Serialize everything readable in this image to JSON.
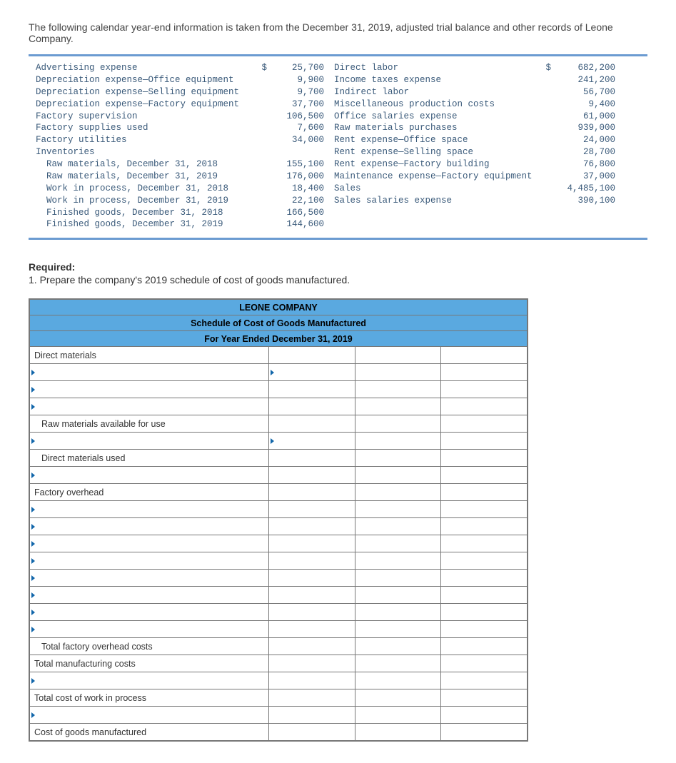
{
  "intro": "The following calendar year-end information is taken from the December 31, 2019, adjusted trial balance and other records of Leone Company.",
  "trial_balance": {
    "left": [
      {
        "label": "Advertising expense",
        "value": "25,700",
        "sym": "$"
      },
      {
        "label": "Depreciation expense—Office equipment",
        "value": "9,900",
        "sym": ""
      },
      {
        "label": "Depreciation expense—Selling equipment",
        "value": "9,700",
        "sym": ""
      },
      {
        "label": "Depreciation expense—Factory equipment",
        "value": "37,700",
        "sym": ""
      },
      {
        "label": "Factory supervision",
        "value": "106,500",
        "sym": ""
      },
      {
        "label": "Factory supplies used",
        "value": "7,600",
        "sym": ""
      },
      {
        "label": "Factory utilities",
        "value": "34,000",
        "sym": ""
      },
      {
        "label": "Inventories",
        "value": "",
        "sym": ""
      },
      {
        "label": "  Raw materials, December 31, 2018",
        "value": "155,100",
        "sym": ""
      },
      {
        "label": "  Raw materials, December 31, 2019",
        "value": "176,000",
        "sym": ""
      },
      {
        "label": "  Work in process, December 31, 2018",
        "value": "18,400",
        "sym": ""
      },
      {
        "label": "  Work in process, December 31, 2019",
        "value": "22,100",
        "sym": ""
      },
      {
        "label": "  Finished goods, December 31, 2018",
        "value": "166,500",
        "sym": ""
      },
      {
        "label": "  Finished goods, December 31, 2019",
        "value": "144,600",
        "sym": ""
      }
    ],
    "right": [
      {
        "label": "Direct labor",
        "value": "682,200",
        "sym": "$"
      },
      {
        "label": "Income taxes expense",
        "value": "241,200",
        "sym": ""
      },
      {
        "label": "Indirect labor",
        "value": "56,700",
        "sym": ""
      },
      {
        "label": "Miscellaneous production costs",
        "value": "9,400",
        "sym": ""
      },
      {
        "label": "Office salaries expense",
        "value": "61,000",
        "sym": ""
      },
      {
        "label": "Raw materials purchases",
        "value": "939,000",
        "sym": ""
      },
      {
        "label": "Rent expense—Office space",
        "value": "24,000",
        "sym": ""
      },
      {
        "label": "Rent expense—Selling space",
        "value": "28,700",
        "sym": ""
      },
      {
        "label": "Rent expense—Factory building",
        "value": "76,800",
        "sym": ""
      },
      {
        "label": "Maintenance expense—Factory equipment",
        "value": "37,000",
        "sym": ""
      },
      {
        "label": "Sales",
        "value": "4,485,100",
        "sym": ""
      },
      {
        "label": "Sales salaries expense",
        "value": "390,100",
        "sym": ""
      },
      {
        "label": "",
        "value": "",
        "sym": ""
      },
      {
        "label": "",
        "value": "",
        "sym": ""
      }
    ]
  },
  "required_header": "Required:",
  "required_text": "1. Prepare the company's 2019 schedule of cost of goods manufactured.",
  "schedule": {
    "h1": "LEONE COMPANY",
    "h2": "Schedule of Cost of Goods Manufactured",
    "h3": "For Year Ended December 31, 2019",
    "rows": {
      "direct_materials": "Direct materials",
      "raw_avail": "Raw materials available for use",
      "direct_used": "Direct materials used",
      "factory_oh": "Factory overhead",
      "total_foh": "Total factory overhead costs",
      "total_mfg": "Total manufacturing costs",
      "total_wip": "Total cost of work in process",
      "cogm": "Cost of goods manufactured"
    }
  }
}
